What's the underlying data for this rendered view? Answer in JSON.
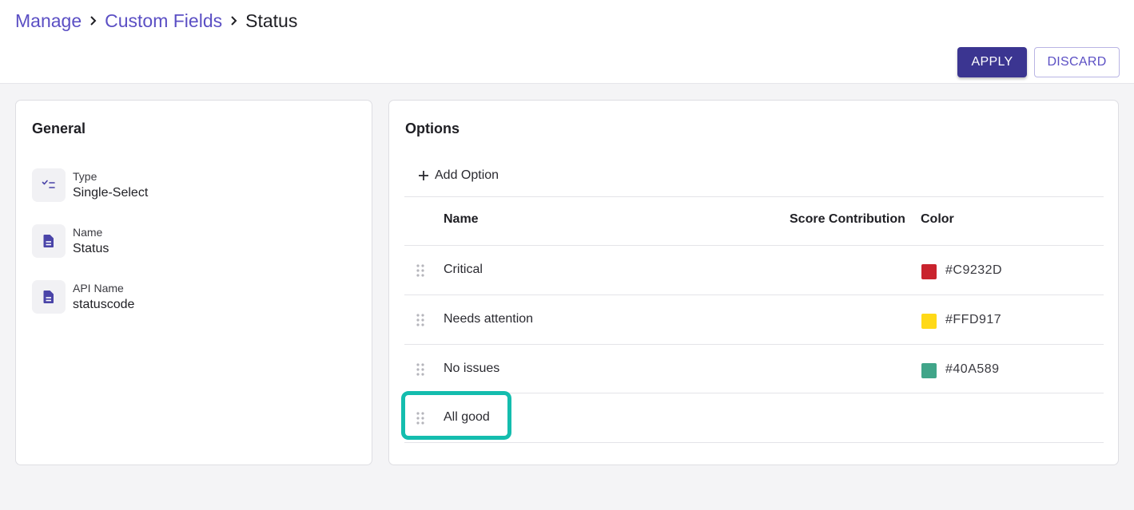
{
  "breadcrumb": [
    {
      "label": "Manage"
    },
    {
      "label": "Custom Fields"
    },
    {
      "label": "Status"
    }
  ],
  "actions": {
    "apply_label": "APPLY",
    "discard_label": "DISCARD"
  },
  "general": {
    "title": "General",
    "properties": [
      {
        "label": "Type",
        "value": "Single-Select",
        "icon": "checklist-icon"
      },
      {
        "label": "Name",
        "value": "Status",
        "icon": "document-icon"
      },
      {
        "label": "API Name",
        "value": "statuscode",
        "icon": "document-icon"
      }
    ]
  },
  "options": {
    "title": "Options",
    "add_label": "Add Option",
    "columns": {
      "name": "Name",
      "score": "Score Contribution",
      "color": "Color"
    },
    "rows": [
      {
        "name": "Critical",
        "color": "#C9232D",
        "color_label": "#C9232D"
      },
      {
        "name": "Needs attention",
        "color": "#FFD917",
        "color_label": "#FFD917"
      },
      {
        "name": "No issues",
        "color": "#40A589",
        "color_label": "#40A589"
      },
      {
        "name": "All good",
        "color": null,
        "color_label": ""
      }
    ]
  },
  "theme": {
    "accent": "#5b4fc4",
    "primary_button": "#3b3591",
    "highlight": "#14bdae"
  }
}
